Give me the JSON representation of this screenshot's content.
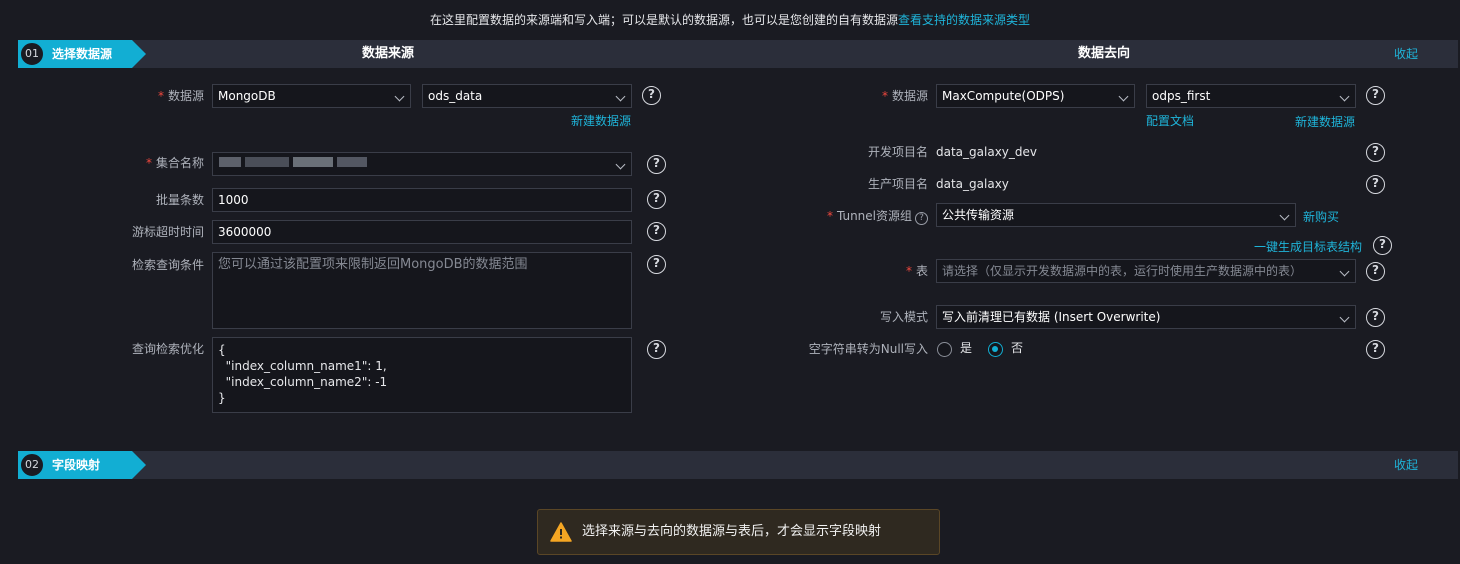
{
  "banner": {
    "text": "在这里配置数据的来源端和写入端；可以是默认的数据源，也可以是您创建的自有数据源",
    "link": "查看支持的数据来源类型"
  },
  "step1": {
    "num": "01",
    "label": "选择数据源",
    "source_title": "数据来源",
    "target_title": "数据去向",
    "collapse": "收起"
  },
  "source": {
    "datasource_label": "数据源",
    "datasource_type": "MongoDB",
    "datasource_name": "ods_data",
    "new_datasource": "新建数据源",
    "collection_label": "集合名称",
    "batch_label": "批量条数",
    "batch_value": "1000",
    "cursor_timeout_label": "游标超时时间",
    "cursor_timeout_value": "3600000",
    "query_label": "检索查询条件",
    "query_placeholder": "您可以通过该配置项来限制返回MongoDB的数据范围",
    "optimize_label": "查询检索优化",
    "optimize_lines": [
      "{",
      "  \"index_column_name1\": 1,",
      "  \"index_column_name2\": -1",
      "}"
    ]
  },
  "target": {
    "datasource_label": "数据源",
    "datasource_type": "MaxCompute(ODPS)",
    "datasource_name": "odps_first",
    "config_doc": "配置文档",
    "new_datasource": "新建数据源",
    "dev_project_label": "开发项目名",
    "dev_project_value": "data_galaxy_dev",
    "prod_project_label": "生产项目名",
    "prod_project_value": "data_galaxy",
    "tunnel_label": "Tunnel资源组",
    "tunnel_value": "公共传输资源",
    "buy_new": "新购买",
    "gen_table": "一键生成目标表结构",
    "table_label": "表",
    "table_placeholder": "请选择（仅显示开发数据源中的表，运行时使用生产数据源中的表）",
    "write_mode_label": "写入模式",
    "write_mode_value": "写入前清理已有数据 (Insert Overwrite)",
    "null_label": "空字符串转为Null写入",
    "yes": "是",
    "no": "否",
    "null_selected": "否"
  },
  "step2": {
    "num": "02",
    "label": "字段映射",
    "collapse": "收起"
  },
  "toast": {
    "message": "选择来源与去向的数据源与表后，才会显示字段映射"
  },
  "colors": {
    "accent": "#12aed3",
    "link": "#1fb4d9",
    "required": "#f0483e",
    "warning": "#f5a623",
    "background": "#1a1b22"
  }
}
